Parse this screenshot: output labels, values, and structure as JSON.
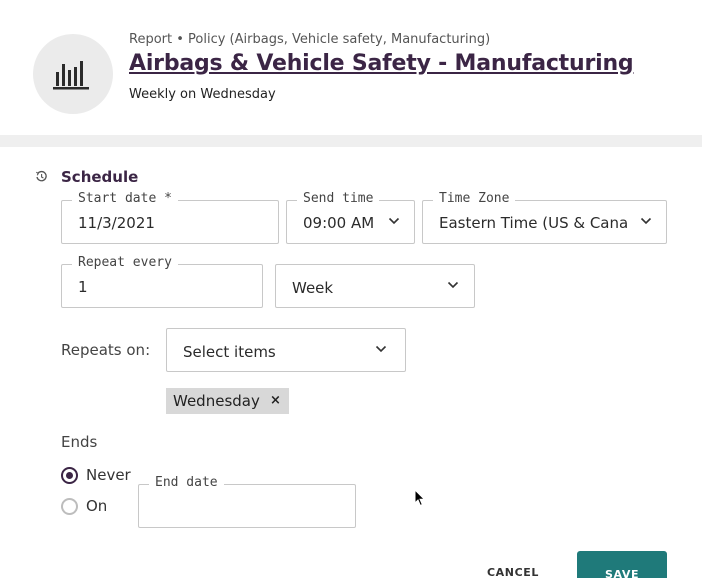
{
  "header": {
    "breadcrumb": "Report • Policy (Airbags, Vehicle safety, Manufacturing)",
    "title": "Airbags & Vehicle Safety - Manufacturing",
    "subtitle": "Weekly on Wednesday",
    "avatar_icon": "bar-chart-icon"
  },
  "schedule": {
    "section_title": "Schedule",
    "section_icon": "history-icon",
    "start_date": {
      "label": "Start date *",
      "value": "11/3/2021"
    },
    "send_time": {
      "label": "Send time",
      "value": "09:00 AM"
    },
    "time_zone": {
      "label": "Time Zone",
      "value": "Eastern Time (US & Canada)"
    },
    "repeat_every": {
      "label": "Repeat every",
      "value": "1"
    },
    "repeat_unit": {
      "value": "Week"
    },
    "repeats_on": {
      "label": "Repeats on:",
      "placeholder": "Select items"
    },
    "selected_days": [
      {
        "label": "Wednesday",
        "remove": "×"
      }
    ],
    "ends": {
      "label": "Ends",
      "options": [
        {
          "label": "Never",
          "checked": true
        },
        {
          "label": "On",
          "checked": false
        }
      ],
      "end_date": {
        "label": "End date",
        "value": ""
      }
    }
  },
  "actions": {
    "cancel": "CANCEL",
    "save": "SAVE"
  },
  "colors": {
    "brand": "#3b2545",
    "primary": "#1f7a7a",
    "chip": "#d8d8d8"
  }
}
